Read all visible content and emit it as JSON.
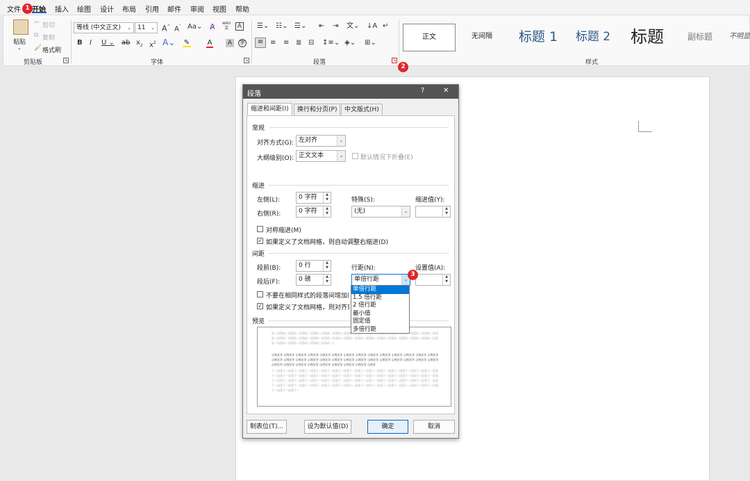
{
  "menu": {
    "tabs": [
      "文件",
      "开始",
      "插入",
      "绘图",
      "设计",
      "布局",
      "引用",
      "邮件",
      "审阅",
      "视图",
      "帮助"
    ],
    "active": "开始"
  },
  "ribbon": {
    "clipboard": {
      "paste": "粘贴",
      "cut": "剪切",
      "copy": "复制",
      "format_painter": "格式刷",
      "label": "剪贴板"
    },
    "font": {
      "name": "等线 (中文正文)",
      "size": "11",
      "label": "字体",
      "grow": "A^",
      "shrink": "Aˇ",
      "case": "Aa",
      "wen": "wén\n文",
      "border_a": "A"
    },
    "paragraph": {
      "label": "段落"
    },
    "styles": {
      "label": "样式",
      "items": [
        "正文",
        "无间隔",
        "标题 1",
        "标题 2",
        "标题",
        "副标题",
        "不明显"
      ]
    }
  },
  "badges": {
    "b1": "1",
    "b2": "2",
    "b3": "3"
  },
  "dialog": {
    "title": "段落",
    "help": "?",
    "close": "✕",
    "tabs": [
      "缩进和间距(I)",
      "换行和分页(P)",
      "中文版式(H)"
    ],
    "general": {
      "section": "常规",
      "align_label": "对齐方式(G):",
      "align_value": "左对齐",
      "outline_label": "大纲级别(O):",
      "outline_value": "正文文本",
      "collapse_label": "默认情况下折叠(E)"
    },
    "indent": {
      "section": "缩进",
      "left_label": "左侧(L):",
      "left_value": "0 字符",
      "right_label": "右侧(R):",
      "right_value": "0 字符",
      "special_label": "特殊(S):",
      "special_value": "(无)",
      "by_label": "缩进值(Y):",
      "mirror_label": "对称缩进(M)",
      "auto_adjust_label": "如果定义了文档网格，则自动调整右缩进(D)"
    },
    "spacing": {
      "section": "间距",
      "before_label": "段前(B):",
      "before_value": "0 行",
      "after_label": "段后(F):",
      "after_value": "0 磅",
      "line_label": "行距(N):",
      "line_value": "单倍行距",
      "at_label": "设置值(A):",
      "no_space_label": "不要在相同样式的段落间增加间距(C)",
      "snap_label": "如果定义了文档网格，则对齐到网格(W)"
    },
    "line_options": [
      "单倍行距",
      "1.5 倍行距",
      "2 倍行距",
      "最小值",
      "固定值",
      "多倍行距"
    ],
    "preview": {
      "section": "预览",
      "prev_text": "前一段落前一段落前一段落前一段落前一段落前一段落前一段落前一段落前一段落前一段落前一段落前一段落前一段落前一段落前一段落前一段落",
      "sample_text": "示例文字 示例文字 示例文字 示例文字 示例文字 示例文字 示例文字 示例文字 示例文字 示例文字 示例文字 示例文字 示例文字 示例文字",
      "next_text": "下一段落下一段落下一段落下一段落下一段落下一段落下一段落下一段落下一段落下一段落下一段落下一段落下一段落下一段落下一段落"
    },
    "buttons": {
      "tabs": "制表位(T)...",
      "default": "设为默认值(D)",
      "ok": "确定",
      "cancel": "取消"
    }
  },
  "colors": {
    "accent": "#0078d7",
    "badge": "#e0262c",
    "title_bar": "#545454"
  }
}
